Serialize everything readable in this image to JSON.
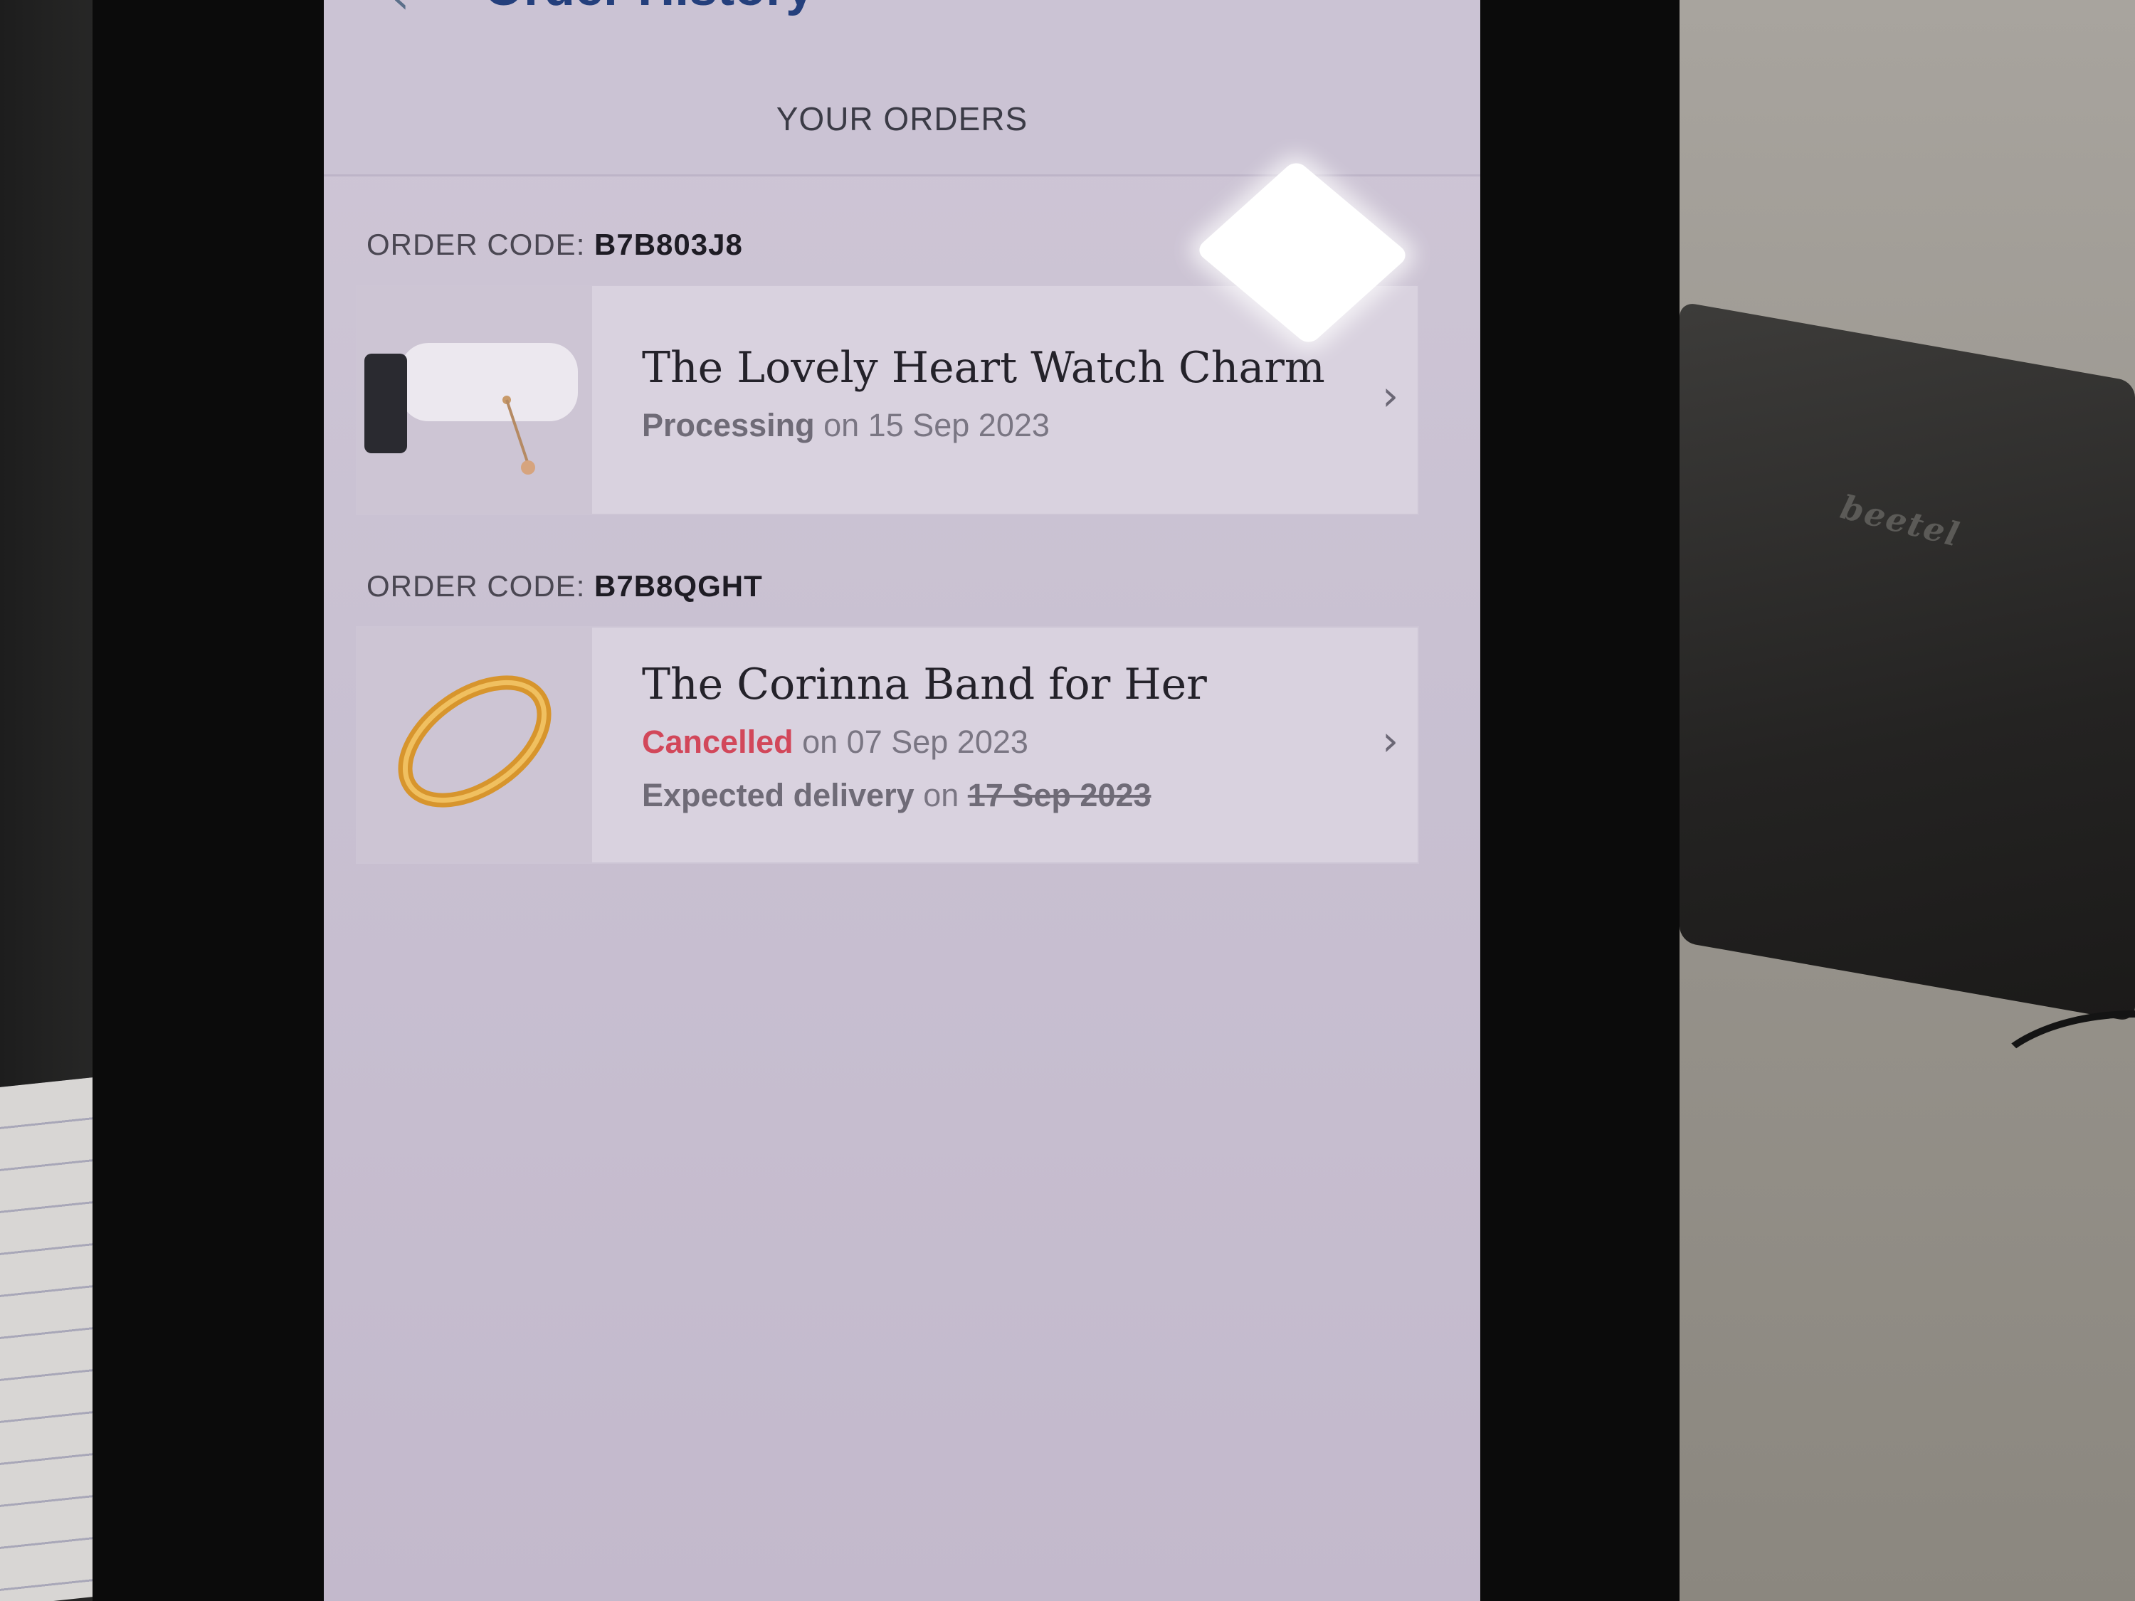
{
  "header": {
    "back_icon": "chevron-left-icon",
    "title": "Order History"
  },
  "section": {
    "title": "YOUR ORDERS"
  },
  "orders": [
    {
      "code_label": "ORDER CODE:",
      "code_value": "B7B803J8",
      "item_name": "The Lovely Heart Watch Charm",
      "status_word": "Processing",
      "status_rest": "on 15 Sep 2023",
      "chevron_icon": "chevron-right-icon",
      "thumb_icon": "watch-charm-thumbnail"
    },
    {
      "code_label": "ORDER CODE:",
      "code_value": "B7B8QGHT",
      "item_name": "The Corinna Band for Her",
      "status_word": "Cancelled",
      "status_rest": "on 07 Sep 2023",
      "delivery_label": "Expected delivery",
      "delivery_on": "on",
      "delivery_date": "17 Sep 2023",
      "chevron_icon": "chevron-right-icon",
      "thumb_icon": "gold-ring-thumbnail"
    }
  ],
  "background": {
    "device_brand": "beetel"
  },
  "colors": {
    "title_blue": "#243f7c",
    "cancelled_red": "#d2475a",
    "screen_bg": "#c9c1d2"
  }
}
